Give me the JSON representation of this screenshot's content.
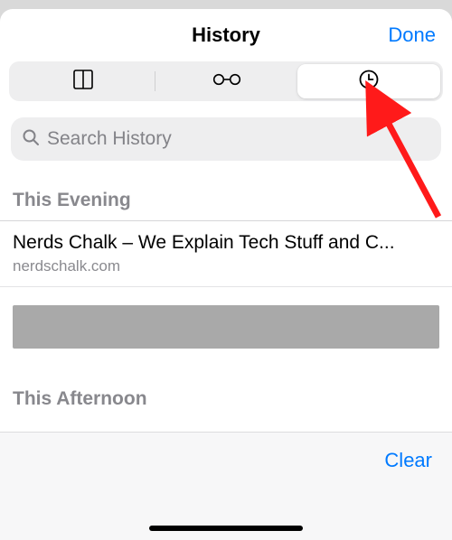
{
  "nav": {
    "title": "History",
    "done_label": "Done"
  },
  "segments": {
    "bookmarks_icon": "bookmarks",
    "reading_list_icon": "glasses",
    "history_icon": "clock"
  },
  "search": {
    "placeholder": "Search History"
  },
  "sections": [
    {
      "header": "This Evening",
      "rows": [
        {
          "title": "Nerds Chalk – We Explain Tech Stuff and C...",
          "domain": "nerdschalk.com"
        }
      ]
    },
    {
      "header": "This Afternoon",
      "rows": []
    }
  ],
  "footer": {
    "clear_label": "Clear"
  }
}
